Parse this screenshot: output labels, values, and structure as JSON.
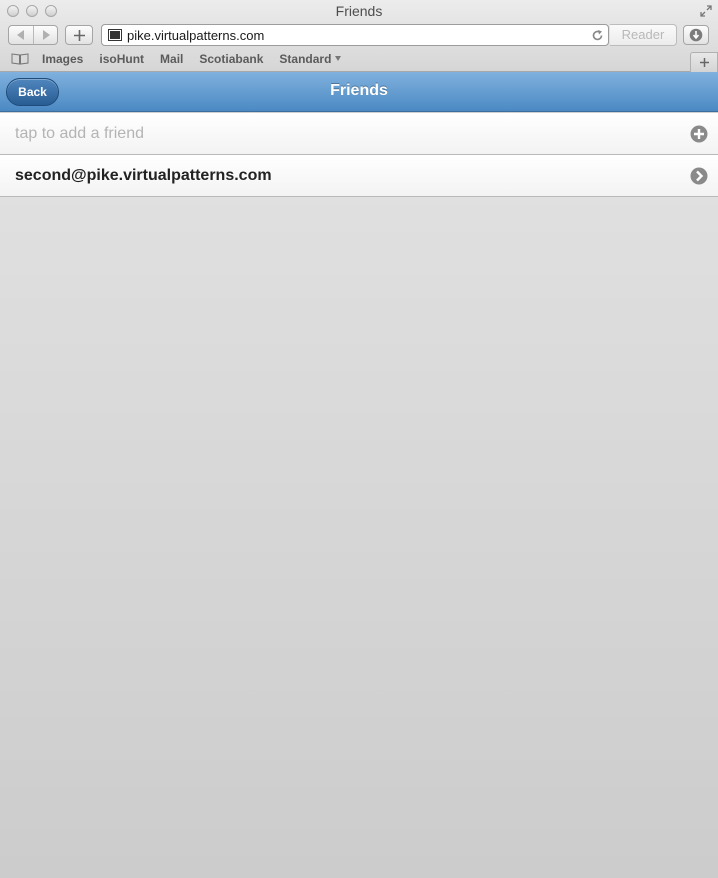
{
  "window": {
    "title": "Friends"
  },
  "toolbar": {
    "url": "pike.virtualpatterns.com",
    "reader_label": "Reader"
  },
  "bookmarks": [
    {
      "label": "Images"
    },
    {
      "label": "isoHunt"
    },
    {
      "label": "Mail"
    },
    {
      "label": "Scotiabank"
    },
    {
      "label": "Standard"
    }
  ],
  "header": {
    "back_label": "Back",
    "title": "Friends"
  },
  "list": {
    "add_placeholder": "tap to add a friend",
    "friends": [
      {
        "email": "second@pike.virtualpatterns.com"
      }
    ]
  },
  "colors": {
    "header_blue": "#5b93cb",
    "back_button": "#3a70a8",
    "icon_gray": "#8a8a8a"
  }
}
